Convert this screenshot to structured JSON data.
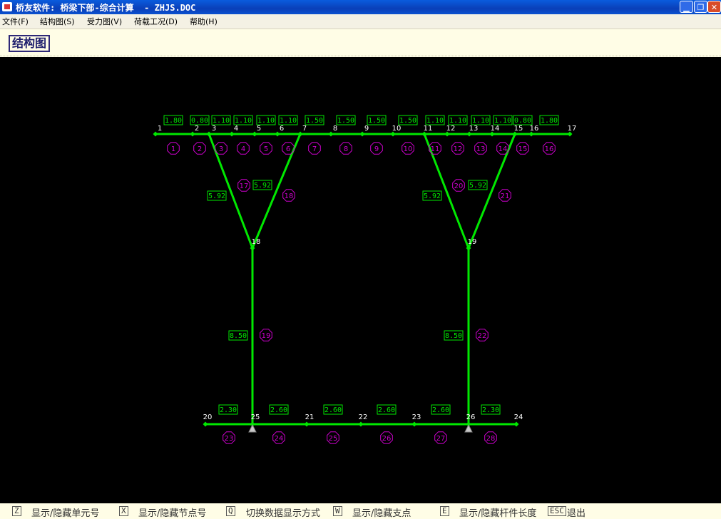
{
  "window": {
    "title": "桥友软件: 桥梁下部-综合计算  - ZHJS.DOC"
  },
  "menu": [
    "文件(F)",
    "结构图(S)",
    "受力图(V)",
    "荷载工况(D)",
    "帮助(H)"
  ],
  "mode_label": "结构图",
  "colors": {
    "member": "#00e800",
    "element_label": "#cc00cc",
    "node_label": "#ffffff",
    "length_box": "#00e800",
    "canvas": "#000000"
  },
  "structure": {
    "nodes": [
      {
        "id": "1"
      },
      {
        "id": "2"
      },
      {
        "id": "3"
      },
      {
        "id": "4"
      },
      {
        "id": "5"
      },
      {
        "id": "6"
      },
      {
        "id": "7"
      },
      {
        "id": "8"
      },
      {
        "id": "9"
      },
      {
        "id": "10"
      },
      {
        "id": "11"
      },
      {
        "id": "12"
      },
      {
        "id": "13"
      },
      {
        "id": "14"
      },
      {
        "id": "15"
      },
      {
        "id": "16"
      },
      {
        "id": "17"
      },
      {
        "id": "18"
      },
      {
        "id": "19"
      },
      {
        "id": "20"
      },
      {
        "id": "21"
      },
      {
        "id": "22"
      },
      {
        "id": "23"
      },
      {
        "id": "24"
      },
      {
        "id": "25"
      },
      {
        "id": "26"
      }
    ],
    "elements": [
      {
        "id": "1",
        "length": "1.80"
      },
      {
        "id": "2",
        "length": "0.80"
      },
      {
        "id": "3",
        "length": "1.10"
      },
      {
        "id": "4",
        "length": "1.10"
      },
      {
        "id": "5",
        "length": "1.10"
      },
      {
        "id": "6",
        "length": "1.10"
      },
      {
        "id": "7",
        "length": "1.50"
      },
      {
        "id": "8",
        "length": "1.50"
      },
      {
        "id": "9",
        "length": "1.50"
      },
      {
        "id": "10",
        "length": "1.50"
      },
      {
        "id": "11",
        "length": "1.10"
      },
      {
        "id": "12",
        "length": "1.10"
      },
      {
        "id": "13",
        "length": "1.10"
      },
      {
        "id": "14",
        "length": "1.10"
      },
      {
        "id": "15",
        "length": "0.80"
      },
      {
        "id": "16",
        "length": "1.80"
      },
      {
        "id": "17",
        "length": "5.92"
      },
      {
        "id": "18",
        "length": "5.92"
      },
      {
        "id": "19",
        "length": "8.50"
      },
      {
        "id": "20",
        "length": "5.92"
      },
      {
        "id": "21",
        "length": "5.92"
      },
      {
        "id": "22",
        "length": "8.50"
      },
      {
        "id": "23",
        "length": "2.30"
      },
      {
        "id": "24",
        "length": "2.60"
      },
      {
        "id": "25",
        "length": "2.60"
      },
      {
        "id": "26",
        "length": "2.60"
      },
      {
        "id": "27",
        "length": "2.60"
      },
      {
        "id": "28",
        "length": "2.30"
      }
    ],
    "supports": [
      "25",
      "26"
    ]
  },
  "status": [
    {
      "key": "Z",
      "label": "显示/隐藏单元号"
    },
    {
      "key": "X",
      "label": "显示/隐藏节点号"
    },
    {
      "key": "Q",
      "label": "切换数据显示方式"
    },
    {
      "key": "W",
      "label": "显示/隐藏支点"
    },
    {
      "key": "E",
      "label": "显示/隐藏杆件长度"
    },
    {
      "key": "ESC",
      "label": "退出"
    }
  ]
}
